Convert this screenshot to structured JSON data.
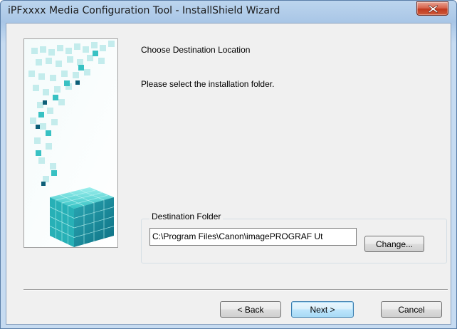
{
  "window": {
    "title": "iPFxxxx Media Configuration Tool - InstallShield Wizard"
  },
  "page": {
    "heading": "Choose Destination Location",
    "instruction": "Please select the installation folder."
  },
  "destination": {
    "group_label": "Destination Folder",
    "path": "C:\\Program Files\\Canon\\imagePROGRAF Ut",
    "change_label": "Change..."
  },
  "buttons": {
    "back_label": "< Back",
    "next_label": "Next >",
    "cancel_label": "Cancel"
  },
  "icons": {
    "close": "close-icon"
  },
  "colors": {
    "accent": "#3c7fb1",
    "close_button": "#c0391f",
    "graphic_teal": "#2fb3b3"
  }
}
